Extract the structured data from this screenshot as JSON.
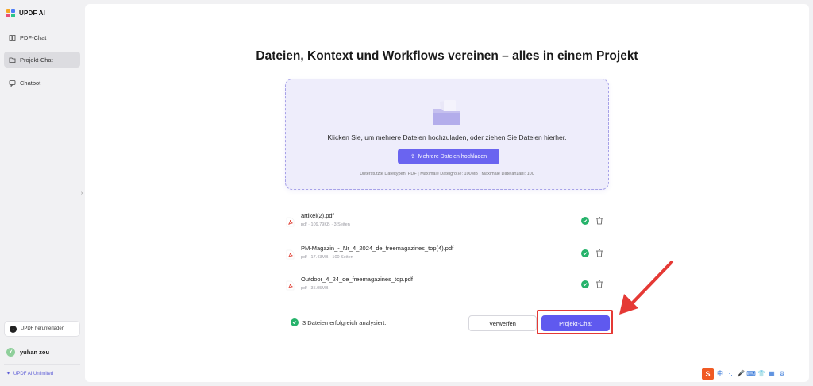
{
  "app": {
    "name": "UPDF AI"
  },
  "sidebar": {
    "items": [
      {
        "label": "PDF-Chat",
        "icon": "book-icon"
      },
      {
        "label": "Projekt-Chat",
        "icon": "folder-icon",
        "active": true
      },
      {
        "label": "Chatbot",
        "icon": "chat-icon"
      }
    ],
    "download_label": "UPDF herunterladen",
    "user": {
      "initial": "Y",
      "name": "yuhan zou"
    },
    "plan_label": "UPDF AI Unlimited"
  },
  "main": {
    "title": "Dateien, Kontext und Workflows vereinen – alles in einem Projekt",
    "dropzone": {
      "instruction": "Klicken Sie, um mehrere Dateien hochzuladen, oder ziehen Sie Dateien hierher.",
      "upload_button": "Mehrere Dateien hochladen",
      "info": "Unterstützte Dateitypen: PDF  |  Maximale Dateigröße: 100MB  |  Maximale Dateianzahl: 100"
    },
    "files": [
      {
        "name": "artikel(2).pdf",
        "meta": "pdf · 109.79KB · 3 Seiten"
      },
      {
        "name": "PM-Magazin_-_Nr_4_2024_de_freemagazines_top(4).pdf",
        "meta": "pdf · 17.43MB · 100 Seiten"
      },
      {
        "name": "Outdoor_4_24_de_freemagazines_top.pdf",
        "meta": "pdf · 35.05MB ·"
      }
    ],
    "status": "3 Dateien erfolgreich analysiert.",
    "cancel_button": "Verwerfen",
    "project_button": "Projekt-Chat"
  },
  "tray": {
    "ime_char": "中",
    "s_label": "S"
  },
  "colors": {
    "accent": "#5f59ef",
    "success": "#26b36b",
    "highlight": "#e53935",
    "file_icon": "#e0453a"
  }
}
